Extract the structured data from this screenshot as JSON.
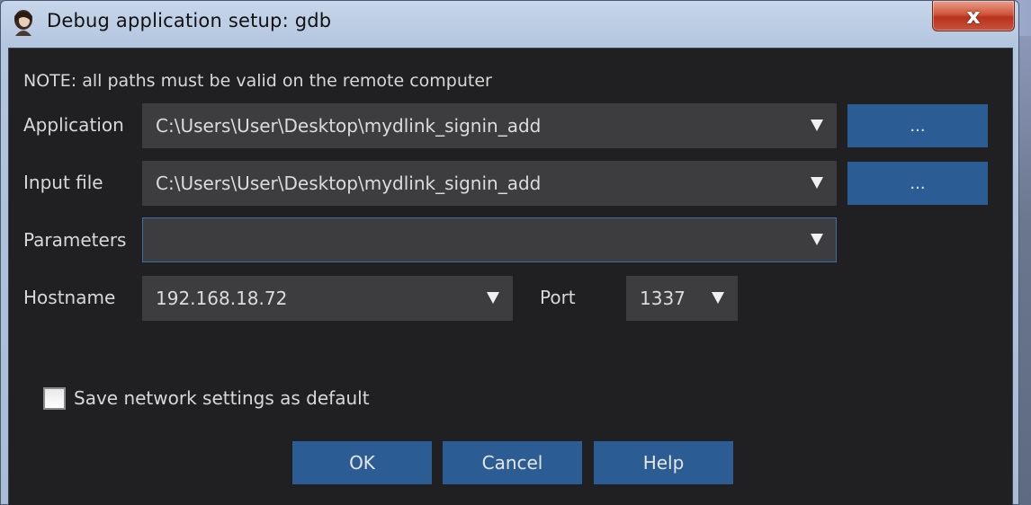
{
  "window": {
    "title": "Debug application setup: gdb",
    "close_label": "x"
  },
  "dialog": {
    "note": "NOTE: all paths must be valid on the remote computer",
    "application": {
      "label": "Application",
      "value": "C:\\Users\\User\\Desktop\\mydlink_signin_add",
      "browse_label": "..."
    },
    "input_file": {
      "label": "Input file",
      "value": "C:\\Users\\User\\Desktop\\mydlink_signin_add",
      "browse_label": "..."
    },
    "parameters": {
      "label": "Parameters",
      "value": ""
    },
    "hostname": {
      "label": "Hostname",
      "value": "192.168.18.72"
    },
    "port": {
      "label": "Port",
      "value": "1337"
    },
    "save_default": {
      "label": "Save network settings as default",
      "checked": false
    },
    "buttons": {
      "ok": "OK",
      "cancel": "Cancel",
      "help": "Help"
    }
  },
  "colors": {
    "dialog_bg": "#202022",
    "field_bg": "#3d3d3f",
    "button_bg": "#2b5d94",
    "focus_border": "#3a6ea5",
    "text": "#d8d8d8"
  },
  "icons": {
    "app_icon": "ida-portrait-icon",
    "dropdown": "chevron-down-icon"
  }
}
